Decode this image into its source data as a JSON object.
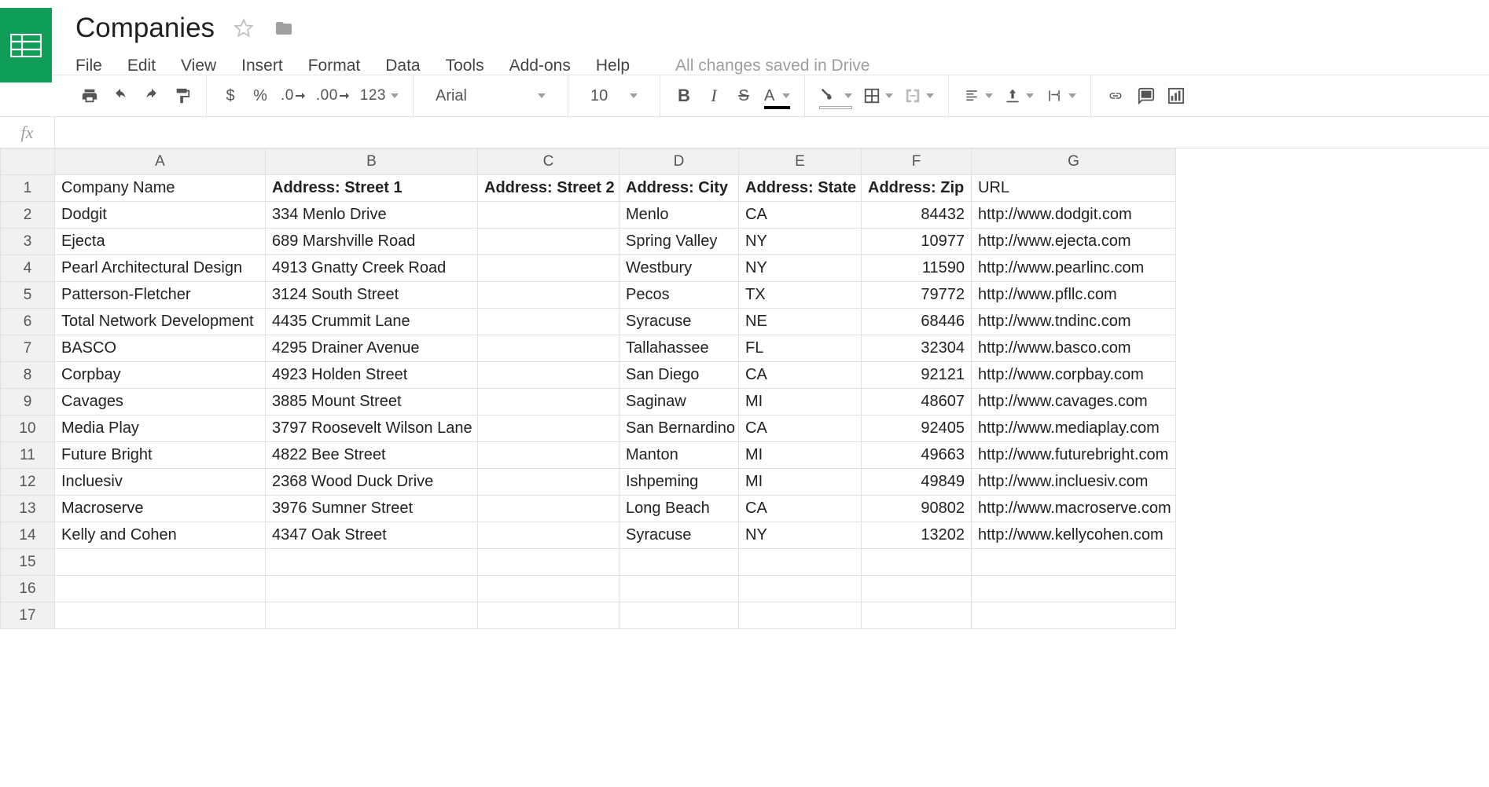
{
  "doc": {
    "title": "Companies",
    "save_status": "All changes saved in Drive"
  },
  "menus": {
    "file": "File",
    "edit": "Edit",
    "view": "View",
    "insert": "Insert",
    "format": "Format",
    "data": "Data",
    "tools": "Tools",
    "addons": "Add-ons",
    "help": "Help"
  },
  "toolbar": {
    "currency": "$",
    "percent": "%",
    "dec_dec": ".0",
    "inc_dec": ".00",
    "num_format": "123",
    "font": "Arial",
    "font_size": "10",
    "bold": "B",
    "italic": "I",
    "strike": "S",
    "text_color": "A"
  },
  "formula": {
    "fx": "fx",
    "value": ""
  },
  "columns": [
    "A",
    "B",
    "C",
    "D",
    "E",
    "F",
    "G"
  ],
  "bold_header_cols": [
    1,
    2,
    3,
    4,
    5
  ],
  "headers": [
    "Company Name",
    "Address: Street 1",
    "Address: Street 2",
    "Address: City",
    "Address: State",
    "Address: Zip",
    "URL"
  ],
  "rows": [
    [
      "Dodgit",
      "334 Menlo Drive",
      "",
      "Menlo",
      "CA",
      "84432",
      "http://www.dodgit.com"
    ],
    [
      "Ejecta",
      "689 Marshville Road",
      "",
      "Spring Valley",
      "NY",
      "10977",
      "http://www.ejecta.com"
    ],
    [
      "Pearl Architectural Design",
      "4913 Gnatty Creek Road",
      "",
      "Westbury",
      "NY",
      "11590",
      "http://www.pearlinc.com"
    ],
    [
      "Patterson-Fletcher",
      "3124 South Street",
      "",
      "Pecos",
      "TX",
      "79772",
      "http://www.pfllc.com"
    ],
    [
      "Total Network Development",
      "4435 Crummit Lane",
      "",
      "Syracuse",
      "NE",
      "68446",
      "http://www.tndinc.com"
    ],
    [
      "BASCO",
      "4295 Drainer Avenue",
      "",
      "Tallahassee",
      "FL",
      "32304",
      "http://www.basco.com"
    ],
    [
      "Corpbay",
      "4923 Holden Street",
      "",
      "San Diego",
      "CA",
      "92121",
      "http://www.corpbay.com"
    ],
    [
      "Cavages",
      "3885 Mount Street",
      "",
      "Saginaw",
      "MI",
      "48607",
      "http://www.cavages.com"
    ],
    [
      "Media Play",
      "3797 Roosevelt Wilson Lane",
      "",
      "San Bernardino",
      "CA",
      "92405",
      "http://www.mediaplay.com"
    ],
    [
      "Future Bright",
      "4822 Bee Street",
      "",
      "Manton",
      "MI",
      "49663",
      "http://www.futurebright.com"
    ],
    [
      "Incluesiv",
      "2368 Wood Duck Drive",
      "",
      "Ishpeming",
      "MI",
      "49849",
      "http://www.incluesiv.com"
    ],
    [
      "Macroserve",
      "3976 Sumner Street",
      "",
      "Long Beach",
      "CA",
      "90802",
      "http://www.macroserve.com"
    ],
    [
      "Kelly and Cohen",
      "4347 Oak Street",
      "",
      "Syracuse",
      "NY",
      "13202",
      "http://www.kellycohen.com"
    ]
  ],
  "empty_rows": 3,
  "numeric_cols": [
    5
  ]
}
